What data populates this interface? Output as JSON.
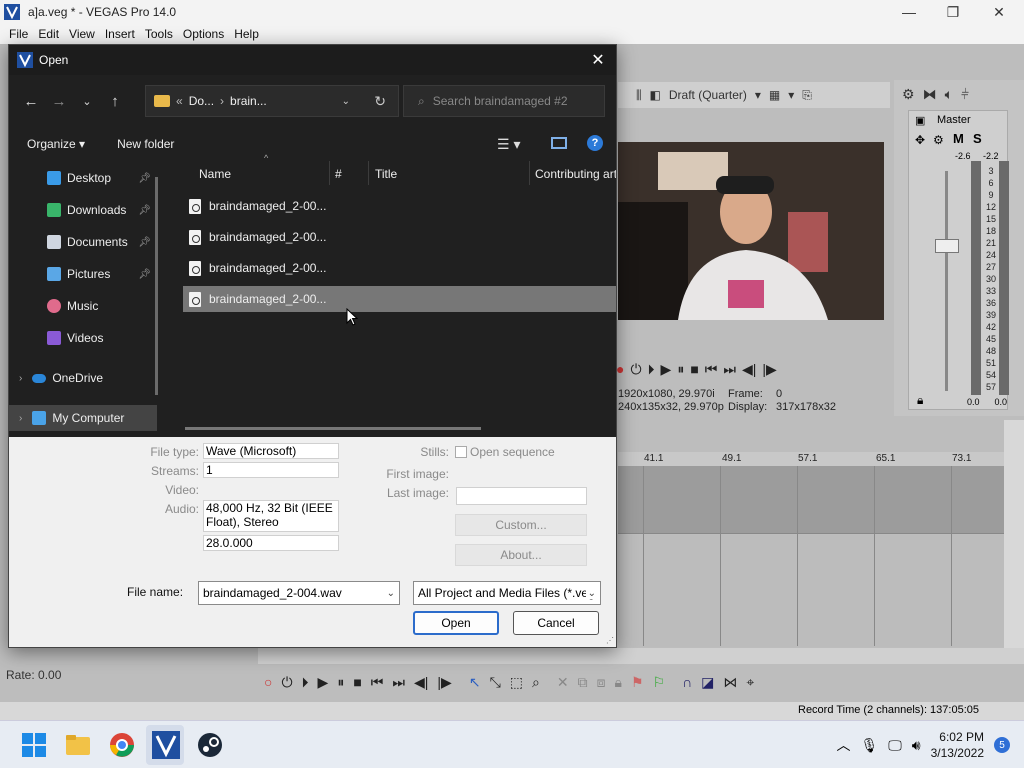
{
  "window": {
    "title": "a]a.veg * - VEGAS Pro 14.0",
    "minimize": "—",
    "maximize": "❐",
    "close": "✕"
  },
  "menu": [
    "File",
    "Edit",
    "View",
    "Insert",
    "Tools",
    "Options",
    "Help"
  ],
  "preview": {
    "quality": "Draft (Quarter)",
    "info_project": "1920x1080, 29.970i",
    "info_preview": "240x135x32, 29.970p",
    "frame_label": "Frame:",
    "frame_value": "0",
    "display_label": "Display:",
    "display_value": "317x178x32"
  },
  "master": {
    "label": "Master",
    "m_btn": "M",
    "s_btn": "S",
    "peak_left": "-2.6",
    "peak_right": "-2.2",
    "scale": [
      "3",
      "6",
      "9",
      "12",
      "15",
      "18",
      "21",
      "24",
      "27",
      "30",
      "33",
      "36",
      "39",
      "42",
      "45",
      "48",
      "51",
      "54",
      "57"
    ],
    "bottom_left": "0.0",
    "bottom_right": "0.0"
  },
  "timeline": {
    "ruler": [
      "41.1",
      "49.1",
      "57.1",
      "65.1",
      "73.1"
    ]
  },
  "rate": "Rate: 0.00",
  "status": {
    "record_time": "Record Time (2 channels): 137:05:05"
  },
  "dialog": {
    "title": "Open",
    "close": "✕",
    "breadcrumb_root": "«",
    "breadcrumb": [
      "Do...",
      "brain..."
    ],
    "search_placeholder": "Search braindamaged #2",
    "organize": "Organize ▾",
    "new_folder": "New folder",
    "help": "?",
    "nav_items": [
      {
        "label": "Desktop",
        "pinned": true,
        "color": "#3a9be8"
      },
      {
        "label": "Downloads",
        "pinned": true,
        "color": "#39b56a"
      },
      {
        "label": "Documents",
        "pinned": true,
        "color": "#cfd6e0"
      },
      {
        "label": "Pictures",
        "pinned": true,
        "color": "#5aa7e6"
      },
      {
        "label": "Music",
        "pinned": false,
        "color": "#e06b8c"
      },
      {
        "label": "Videos",
        "pinned": false,
        "color": "#8a5ad6"
      },
      {
        "label": "OneDrive",
        "pinned": false,
        "color": "#2a86d8"
      },
      {
        "label": "My Computer",
        "pinned": false,
        "color": "#4aa3e8"
      }
    ],
    "columns": [
      "Name",
      "#",
      "Title",
      "Contributing art"
    ],
    "files": [
      "braindamaged_2-00...",
      "braindamaged_2-00...",
      "braindamaged_2-00...",
      "braindamaged_2-00..."
    ],
    "selected_index": 3,
    "props": {
      "file_type_label": "File type:",
      "file_type": "Wave (Microsoft)",
      "streams_label": "Streams:",
      "streams": "1",
      "video_label": "Video:",
      "audio_label": "Audio:",
      "audio": "48,000 Hz, 32 Bit (IEEE Float), Stereo",
      "length": "28.0.000",
      "stills_label": "Stills:",
      "open_sequence": "Open sequence",
      "first_image_label": "First image:",
      "last_image_label": "Last image:",
      "custom": "Custom...",
      "about": "About..."
    },
    "file_name_label": "File name:",
    "file_name": "braindamaged_2-004.wav",
    "file_filter": "All Project and Media Files (*.veg",
    "open_btn": "Open",
    "cancel_btn": "Cancel"
  },
  "taskbar": {
    "time": "6:02 PM",
    "date": "3/13/2022",
    "notifications": "5"
  }
}
